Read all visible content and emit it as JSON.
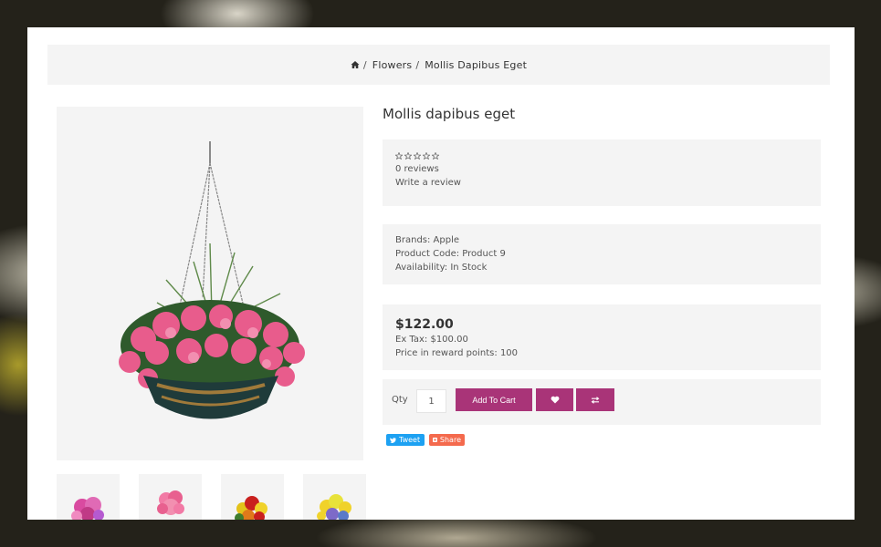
{
  "breadcrumb": {
    "home_icon": "home-icon",
    "items": [
      "Flowers",
      "Mollis Dapibus Eget"
    ]
  },
  "product": {
    "title": "Mollis dapibus eget",
    "reviews_count": "0 reviews",
    "write_review": "Write a review",
    "rating": 0,
    "brand": "Brands: Apple",
    "code": "Product Code: Product 9",
    "availability": "Availability: In Stock",
    "price": "$122.00",
    "ex_tax": "Ex Tax: $100.00",
    "reward_points": "Price in reward points: 100"
  },
  "cart": {
    "qty_label": "Qty",
    "qty_value": "1",
    "add_to_cart": "Add To Cart",
    "wishlist_icon": "heart-icon",
    "compare_icon": "exchange-icon"
  },
  "social": {
    "tweet": "Tweet",
    "share": "Share"
  },
  "colors": {
    "accent": "#a93478",
    "panel_bg": "#f4f4f4",
    "tweet": "#1da1f2",
    "share": "#f46a4d"
  }
}
